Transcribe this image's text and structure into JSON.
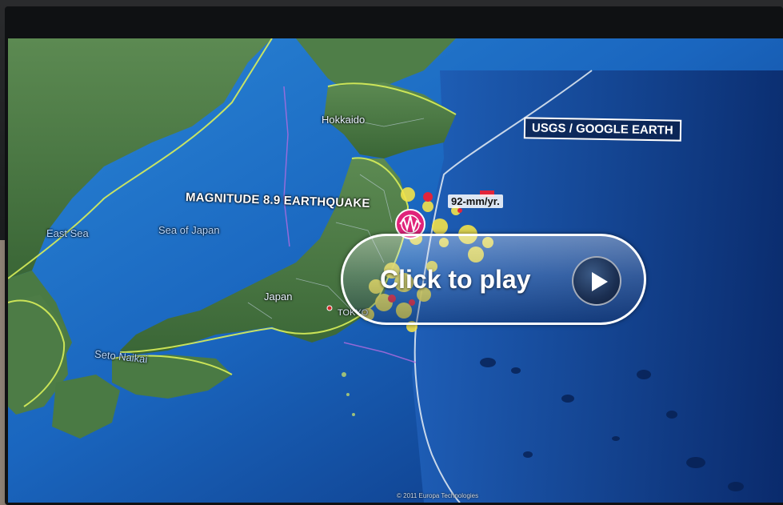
{
  "video": {
    "overlay_label": "Click to play",
    "play_icon": "play-icon"
  },
  "map": {
    "source_badge": "USGS / GOOGLE EARTH",
    "quake_label": "MAGNITUDE 8.9 EARTHQUAKE",
    "plate_rate": "92-mm/yr.",
    "places": {
      "hokkaido": "Hokkaido",
      "japan": "Japan",
      "tokyo": "TOKYO",
      "east_sea": "East Sea",
      "sea_of_japan": "Sea of Japan",
      "seto_naikai": "Seto Naikai"
    },
    "copyright": "© 2011 Europa Technologies"
  },
  "colors": {
    "ocean_deep": "#0c3f8f",
    "ocean_shallow": "#2c7fd0",
    "land": "#3f6b3a",
    "border_line": "#d9ef5a",
    "aftershock": "#f2e24a",
    "quake_marker": "#e0237a"
  }
}
